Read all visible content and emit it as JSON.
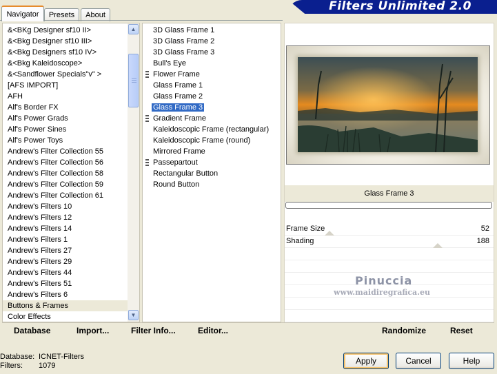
{
  "tabs": [
    "Navigator",
    "Presets",
    "About"
  ],
  "app_title": "Filters Unlimited 2.0",
  "categories": [
    "&<BKg Designer sf10 II>",
    "&<Bkg Designer sf10 III>",
    "&<Bkg Designers sf10 IV>",
    "&<Bkg Kaleidoscope>",
    "&<Sandflower Specials\"v\" >",
    "[AFS IMPORT]",
    "AFH",
    "Alf's Border FX",
    "Alf's Power Grads",
    "Alf's Power Sines",
    "Alf's Power Toys",
    "Andrew's Filter Collection 55",
    "Andrew's Filter Collection 56",
    "Andrew's Filter Collection 58",
    "Andrew's Filter Collection 59",
    "Andrew's Filter Collection 61",
    "Andrew's Filters 10",
    "Andrew's Filters 12",
    "Andrew's Filters 14",
    "Andrew's Filters 1",
    "Andrew's Filters 27",
    "Andrew's Filters 29",
    "Andrew's Filters 44",
    "Andrew's Filters 51",
    "Andrew's Filters 6",
    "Buttons & Frames",
    "Color Effects"
  ],
  "selected_category": "Buttons & Frames",
  "filters": [
    {
      "label": "3D Glass Frame 1",
      "marked": false
    },
    {
      "label": "3D Glass Frame 2",
      "marked": false
    },
    {
      "label": "3D Glass Frame 3",
      "marked": false
    },
    {
      "label": "Bull's Eye",
      "marked": false
    },
    {
      "label": "Flower Frame",
      "marked": true
    },
    {
      "label": "Glass Frame 1",
      "marked": false
    },
    {
      "label": "Glass Frame 2",
      "marked": false
    },
    {
      "label": "Glass Frame 3",
      "marked": false
    },
    {
      "label": "Gradient Frame",
      "marked": true
    },
    {
      "label": "Kaleidoscopic Frame (rectangular)",
      "marked": false
    },
    {
      "label": "Kaleidoscopic Frame (round)",
      "marked": false
    },
    {
      "label": "Mirrored Frame",
      "marked": false
    },
    {
      "label": "Passepartout",
      "marked": true
    },
    {
      "label": "Rectangular Button",
      "marked": false
    },
    {
      "label": "Round Button",
      "marked": false
    }
  ],
  "selected_filter": "Glass Frame 3",
  "preview": {
    "filter_name": "Glass Frame 3"
  },
  "params": [
    {
      "name": "Frame Size",
      "value": "52",
      "level": 0.2
    },
    {
      "name": "Shading",
      "value": "188",
      "level": 0.74
    }
  ],
  "watermark": {
    "line1": "Pinuccia",
    "line2": "www.maidiregrafica.eu"
  },
  "toolbar": {
    "database": "Database",
    "import": "Import...",
    "filter_info": "Filter Info...",
    "editor": "Editor...",
    "randomize": "Randomize",
    "reset": "Reset"
  },
  "status": {
    "database_label": "Database:",
    "database_value": "ICNET-Filters",
    "filters_label": "Filters:",
    "filters_value": "1079"
  },
  "buttons": {
    "apply": "Apply",
    "cancel": "Cancel",
    "help": "Help"
  },
  "colors": {
    "selection": "#316ac5",
    "banner": "#0a1f8f",
    "dialog": "#ece9d8"
  }
}
